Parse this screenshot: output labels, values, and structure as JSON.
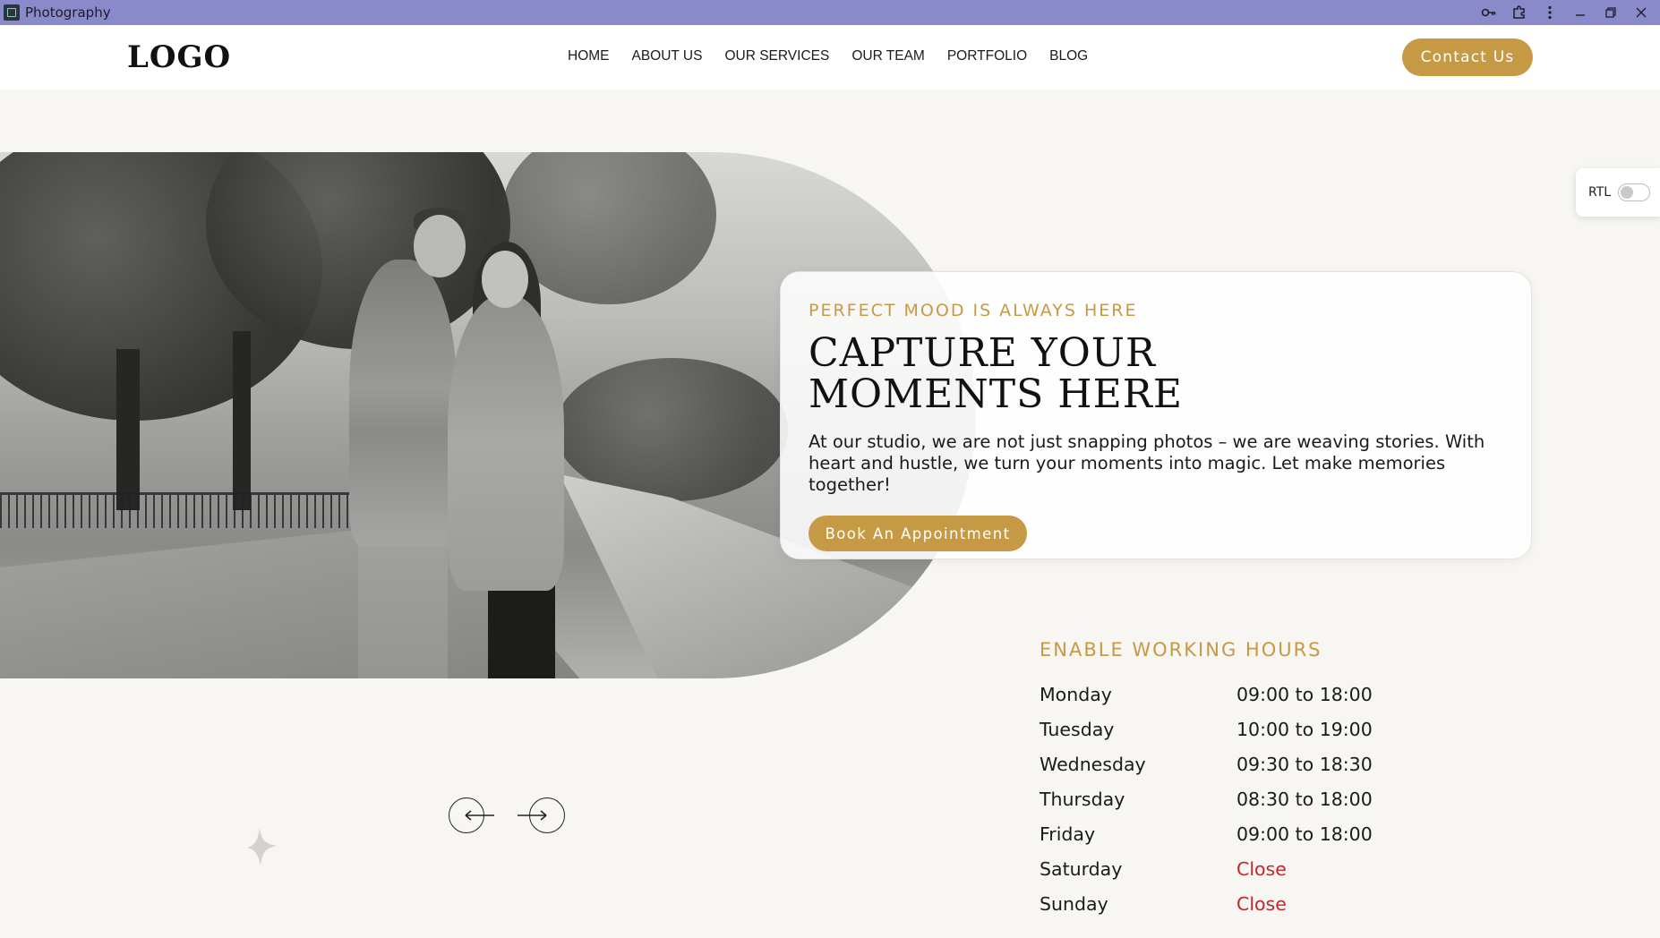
{
  "window": {
    "title": "Photography",
    "controls": [
      "key-icon",
      "extensions-icon",
      "more-vertical-icon",
      "minimize-icon",
      "restore-icon",
      "close-icon"
    ]
  },
  "header": {
    "logo": "LOGO",
    "nav": [
      "HOME",
      "ABOUT US",
      "OUR SERVICES",
      "OUR TEAM",
      "PORTFOLIO",
      "BLOG"
    ],
    "contact_label": "Contact Us"
  },
  "hero": {
    "eyebrow": "PERFECT MOOD IS ALWAYS HERE",
    "title_line1": "CAPTURE YOUR",
    "title_line2": "MOMENTS HERE",
    "text": "At our studio, we are not just snapping photos – we are weaving stories. With heart and hustle, we turn your moments into magic. Let make memories together!",
    "book_label": "Book An Appointment"
  },
  "rtl": {
    "label": "RTL",
    "enabled": false
  },
  "hours": {
    "title": "ENABLE WORKING HOURS",
    "rows": [
      {
        "day": "Monday",
        "time": "09:00 to 18:00",
        "closed": false
      },
      {
        "day": "Tuesday",
        "time": "10:00 to 19:00",
        "closed": false
      },
      {
        "day": "Wednesday",
        "time": "09:30 to 18:30",
        "closed": false
      },
      {
        "day": "Thursday",
        "time": "08:30 to 18:00",
        "closed": false
      },
      {
        "day": "Friday",
        "time": "09:00 to 18:00",
        "closed": false
      },
      {
        "day": "Saturday",
        "time": "Close",
        "closed": true
      },
      {
        "day": "Sunday",
        "time": "Close",
        "closed": true
      }
    ]
  },
  "slider": {
    "prev_icon": "arrow-left-icon",
    "next_icon": "arrow-right-icon"
  },
  "colors": {
    "accent": "#c69a45",
    "titlebar": "#8a89c9",
    "closed": "#c4242b",
    "background": "#f7f6f3"
  }
}
